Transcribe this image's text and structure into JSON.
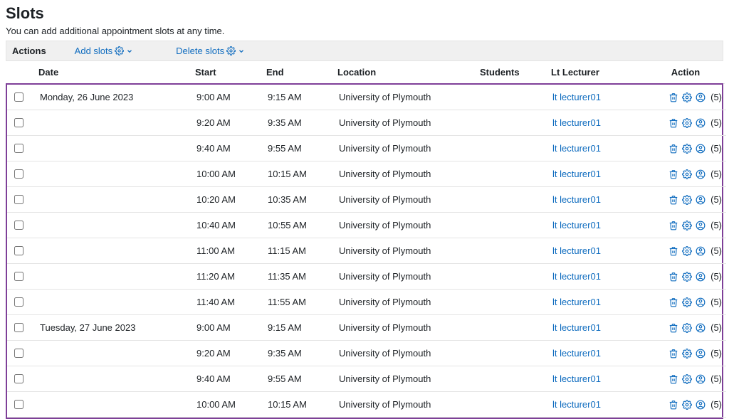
{
  "heading": "Slots",
  "subtitle": "You can add additional appointment slots at any time.",
  "actions_bar": {
    "label": "Actions",
    "add": "Add slots",
    "delete": "Delete slots"
  },
  "columns": {
    "date": "Date",
    "start": "Start",
    "end": "End",
    "location": "Location",
    "students": "Students",
    "lecturer": "Lt Lecturer",
    "action": "Action"
  },
  "rows": [
    {
      "date": "Monday, 26 June 2023",
      "start": "9:00 AM",
      "end": "9:15 AM",
      "location": "University of Plymouth",
      "students": "",
      "lecturer": "lt lecturer01",
      "count": "(5)"
    },
    {
      "date": "",
      "start": "9:20 AM",
      "end": "9:35 AM",
      "location": "University of Plymouth",
      "students": "",
      "lecturer": "lt lecturer01",
      "count": "(5)"
    },
    {
      "date": "",
      "start": "9:40 AM",
      "end": "9:55 AM",
      "location": "University of Plymouth",
      "students": "",
      "lecturer": "lt lecturer01",
      "count": "(5)"
    },
    {
      "date": "",
      "start": "10:00 AM",
      "end": "10:15 AM",
      "location": "University of Plymouth",
      "students": "",
      "lecturer": "lt lecturer01",
      "count": "(5)"
    },
    {
      "date": "",
      "start": "10:20 AM",
      "end": "10:35 AM",
      "location": "University of Plymouth",
      "students": "",
      "lecturer": "lt lecturer01",
      "count": "(5)"
    },
    {
      "date": "",
      "start": "10:40 AM",
      "end": "10:55 AM",
      "location": "University of Plymouth",
      "students": "",
      "lecturer": "lt lecturer01",
      "count": "(5)"
    },
    {
      "date": "",
      "start": "11:00 AM",
      "end": "11:15 AM",
      "location": "University of Plymouth",
      "students": "",
      "lecturer": "lt lecturer01",
      "count": "(5)"
    },
    {
      "date": "",
      "start": "11:20 AM",
      "end": "11:35 AM",
      "location": "University of Plymouth",
      "students": "",
      "lecturer": "lt lecturer01",
      "count": "(5)"
    },
    {
      "date": "",
      "start": "11:40 AM",
      "end": "11:55 AM",
      "location": "University of Plymouth",
      "students": "",
      "lecturer": "lt lecturer01",
      "count": "(5)"
    },
    {
      "date": "Tuesday, 27 June 2023",
      "start": "9:00 AM",
      "end": "9:15 AM",
      "location": "University of Plymouth",
      "students": "",
      "lecturer": "lt lecturer01",
      "count": "(5)"
    },
    {
      "date": "",
      "start": "9:20 AM",
      "end": "9:35 AM",
      "location": "University of Plymouth",
      "students": "",
      "lecturer": "lt lecturer01",
      "count": "(5)"
    },
    {
      "date": "",
      "start": "9:40 AM",
      "end": "9:55 AM",
      "location": "University of Plymouth",
      "students": "",
      "lecturer": "lt lecturer01",
      "count": "(5)"
    },
    {
      "date": "",
      "start": "10:00 AM",
      "end": "10:15 AM",
      "location": "University of Plymouth",
      "students": "",
      "lecturer": "lt lecturer01",
      "count": "(5)"
    }
  ]
}
